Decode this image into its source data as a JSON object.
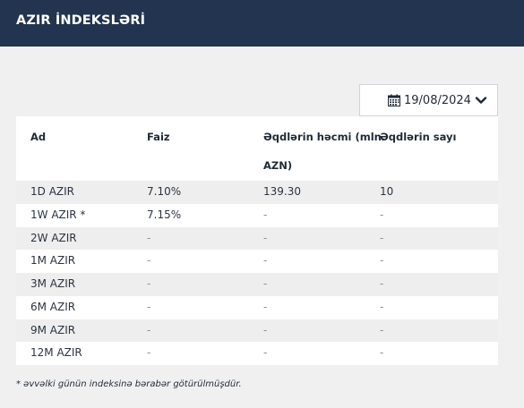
{
  "header": {
    "title": "AZIR İNDEKSLƏRİ"
  },
  "date_picker": {
    "value": "19/08/2024",
    "icon": "calendar-icon",
    "toggle_icon": "chevron-down-icon"
  },
  "table": {
    "headers": [
      "Ad",
      "Faiz",
      "Əqdlərin həcmi (mln.",
      "AZN)",
      "Əqdlərin sayı"
    ],
    "rows": [
      [
        "1D AZIR",
        "7.10%",
        "139.30",
        "10"
      ],
      [
        "1W AZIR *",
        "7.15%",
        "-",
        "-"
      ],
      [
        "2W AZIR",
        "-",
        "-",
        "-"
      ],
      [
        "1M AZIR",
        "-",
        "-",
        "-"
      ],
      [
        "3M AZIR",
        "-",
        "-",
        "-"
      ],
      [
        "6M AZIR",
        "-",
        "-",
        "-"
      ],
      [
        "9M AZIR",
        "-",
        "-",
        "-"
      ],
      [
        "12M AZIR",
        "-",
        "-",
        "-"
      ]
    ]
  },
  "footnote": "* əvvəlki günün indeksinə bərabər götürülmüşdür."
}
